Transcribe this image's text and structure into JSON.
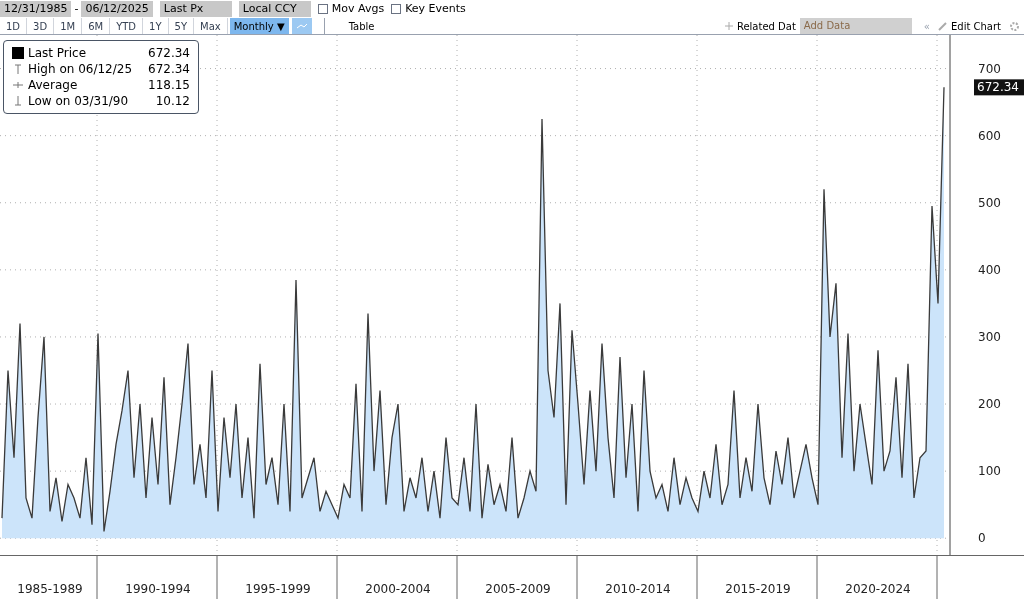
{
  "toolbar": {
    "start_date": "12/31/1985",
    "date_separator": "-",
    "end_date": "06/12/2025",
    "field": "Last Px",
    "currency": "Local CCY",
    "checkboxes": [
      {
        "label": "Mov Avgs",
        "checked": false
      },
      {
        "label": "Key Events",
        "checked": false
      }
    ],
    "periods": [
      {
        "label": "1D",
        "selected": false
      },
      {
        "label": "3D",
        "selected": false
      },
      {
        "label": "1M",
        "selected": false
      },
      {
        "label": "6M",
        "selected": false
      },
      {
        "label": "YTD",
        "selected": false
      },
      {
        "label": "1Y",
        "selected": false
      },
      {
        "label": "5Y",
        "selected": false
      },
      {
        "label": "Max",
        "selected": false
      }
    ],
    "frequency": "Monthly ▼",
    "table_tab": "Table",
    "related_data": "Related Dat",
    "add_data": "Add Data",
    "collapse": "«",
    "edit_chart": "Edit Chart"
  },
  "legend": [
    {
      "kind": "square",
      "value": "672.34"
    },
    {
      "kind": "high",
      "label": "High on 06/12/25",
      "value": "672.34"
    },
    {
      "kind": "average",
      "label": "Average",
      "value": "118.15"
    },
    {
      "kind": "low",
      "label": "Low on 03/31/90",
      "value": "10.12"
    }
  ],
  "last_value_label": "672.34",
  "chart_data": {
    "type": "area",
    "grid": true,
    "ylim": [
      -25,
      750
    ],
    "yticks": [
      0,
      100,
      200,
      300,
      400,
      500,
      600,
      700
    ],
    "categories": [
      null,
      null,
      null,
      null,
      null,
      null,
      null,
      null,
      "1985-1989",
      null,
      null,
      null,
      null,
      null,
      null,
      null,
      null,
      null,
      null,
      null,
      null,
      null,
      null,
      null,
      null,
      null,
      "1990-1994",
      null,
      null,
      null,
      null,
      null,
      null,
      null,
      null,
      null,
      null,
      null,
      null,
      null,
      null,
      null,
      null,
      null,
      null,
      null,
      "1995-1999",
      null,
      null,
      null,
      null,
      null,
      null,
      null,
      null,
      null,
      null,
      null,
      null,
      null,
      null,
      null,
      null,
      null,
      null,
      null,
      "2000-2004",
      null,
      null,
      null,
      null,
      null,
      null,
      null,
      null,
      null,
      null,
      null,
      null,
      null,
      null,
      null,
      null,
      null,
      null,
      null,
      "2005-2009",
      null,
      null,
      null,
      null,
      null,
      null,
      null,
      null,
      null,
      null,
      null,
      null,
      null,
      null,
      null,
      null,
      null,
      null,
      null,
      "2010-2014",
      null,
      null,
      null,
      null,
      null,
      null,
      null,
      null,
      null,
      null,
      null,
      null,
      null,
      null,
      null,
      null,
      null,
      null,
      null,
      "2015-2019",
      null,
      null,
      null,
      null,
      null,
      null,
      null,
      null,
      null,
      null,
      null,
      null,
      null,
      null,
      null,
      null,
      null,
      null,
      null,
      "2020-2024",
      null,
      null,
      null,
      null,
      null,
      null,
      null,
      null,
      null,
      null,
      null
    ],
    "series": [
      {
        "name": "Last Price",
        "color": "#3a3a3a",
        "values": [
          30,
          250,
          120,
          320,
          60,
          30,
          180,
          300,
          40,
          90,
          25,
          80,
          60,
          30,
          120,
          20,
          305,
          10,
          70,
          140,
          190,
          250,
          90,
          200,
          60,
          180,
          80,
          240,
          50,
          120,
          200,
          290,
          80,
          140,
          60,
          250,
          40,
          180,
          90,
          200,
          60,
          150,
          30,
          260,
          80,
          120,
          50,
          200,
          40,
          385,
          60,
          90,
          120,
          40,
          70,
          50,
          30,
          80,
          60,
          230,
          40,
          335,
          100,
          220,
          50,
          150,
          200,
          40,
          90,
          60,
          120,
          40,
          100,
          30,
          150,
          60,
          50,
          120,
          40,
          200,
          30,
          110,
          50,
          80,
          40,
          150,
          30,
          60,
          100,
          70,
          625,
          250,
          180,
          350,
          50,
          310,
          200,
          80,
          220,
          100,
          290,
          150,
          60,
          270,
          90,
          200,
          40,
          250,
          100,
          60,
          80,
          40,
          120,
          50,
          90,
          60,
          40,
          100,
          60,
          140,
          50,
          80,
          220,
          60,
          120,
          70,
          200,
          90,
          50,
          130,
          80,
          150,
          60,
          100,
          140,
          90,
          50,
          520,
          300,
          380,
          120,
          305,
          100,
          200,
          140,
          80,
          280,
          100,
          130,
          240,
          90,
          260,
          60,
          120,
          130,
          495,
          350,
          672
        ]
      }
    ]
  }
}
